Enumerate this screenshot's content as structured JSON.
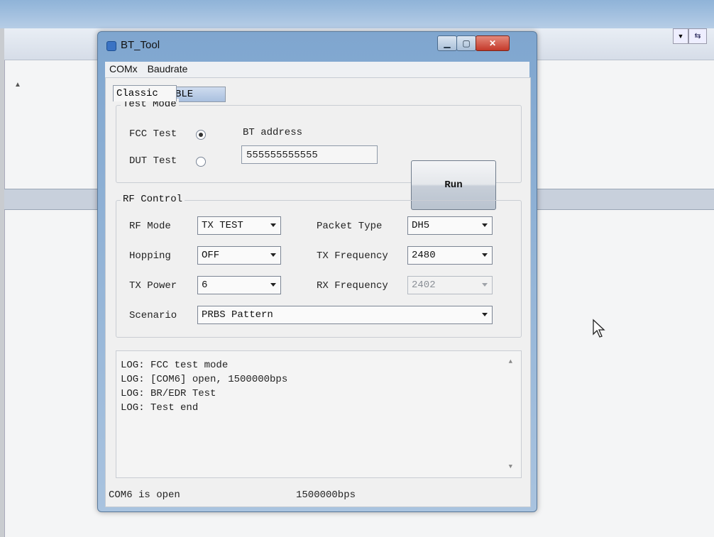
{
  "window": {
    "title": "BT_Tool"
  },
  "menu": {
    "items": [
      "COMx",
      "Baudrate"
    ]
  },
  "tabs": {
    "active": "Classic",
    "inactive": "BLE"
  },
  "test_mode": {
    "group_label": "Test Mode",
    "fcc_label": "FCC Test",
    "dut_label": "DUT Test",
    "selected": "FCC Test",
    "bt_address_label": "BT address",
    "bt_address_value": "555555555555",
    "run_label": "Run"
  },
  "rf_control": {
    "group_label": "RF Control",
    "rf_mode_label": "RF Mode",
    "rf_mode_value": "TX TEST",
    "hopping_label": "Hopping",
    "hopping_value": "OFF",
    "tx_power_label": "TX Power",
    "tx_power_value": "6",
    "packet_type_label": "Packet Type",
    "packet_type_value": "DH5",
    "tx_frequency_label": "TX Frequency",
    "tx_frequency_value": "2480",
    "rx_frequency_label": "RX Frequency",
    "rx_frequency_value": "2402",
    "scenario_label": "Scenario",
    "scenario_value": "PRBS Pattern"
  },
  "log": {
    "lines": [
      "LOG: FCC test mode",
      "LOG: [COM6] open, 1500000bps",
      "LOG: BR/EDR Test",
      "LOG: Test end"
    ]
  },
  "status": {
    "port": "COM6 is open",
    "baud": "1500000bps"
  },
  "icons": {
    "close": "close-icon",
    "minimize": "minimize-icon",
    "maximize": "maximize-icon",
    "cursor": "mouse-cursor-icon"
  }
}
